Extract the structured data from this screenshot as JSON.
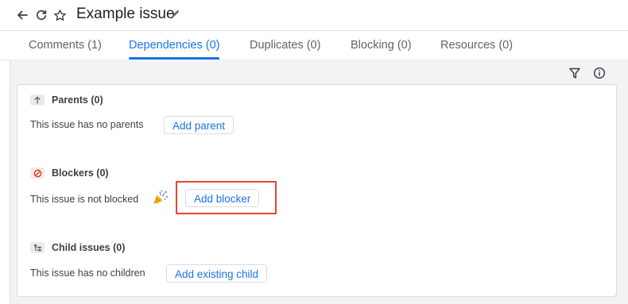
{
  "header": {
    "title": "Example issue",
    "icons": [
      "back-arrow-icon",
      "refresh-icon",
      "star-icon",
      "pencil-icon"
    ]
  },
  "tabs": [
    {
      "label": "Comments (1)",
      "active": false
    },
    {
      "label": "Dependencies (0)",
      "active": true
    },
    {
      "label": "Duplicates (0)",
      "active": false
    },
    {
      "label": "Blocking (0)",
      "active": false
    },
    {
      "label": "Resources (0)",
      "active": false
    }
  ],
  "toolbar": {
    "icons": [
      "filter-icon",
      "info-icon"
    ]
  },
  "sections": {
    "parents": {
      "title": "Parents (0)",
      "description": "This issue has no parents",
      "button": "Add parent",
      "icon": "arrow-up-icon"
    },
    "blockers": {
      "title": "Blockers (0)",
      "description": "This issue is not blocked",
      "button": "Add blocker",
      "icon": "blocked-icon",
      "emoji": "party-popper-icon"
    },
    "children": {
      "title": "Child issues (0)",
      "description": "This issue has no children",
      "button": "Add existing child",
      "icon": "hierarchy-icon"
    }
  },
  "colors": {
    "accent": "#1a73e8",
    "highlight": "#ea4335",
    "blocked": "#d93025"
  }
}
